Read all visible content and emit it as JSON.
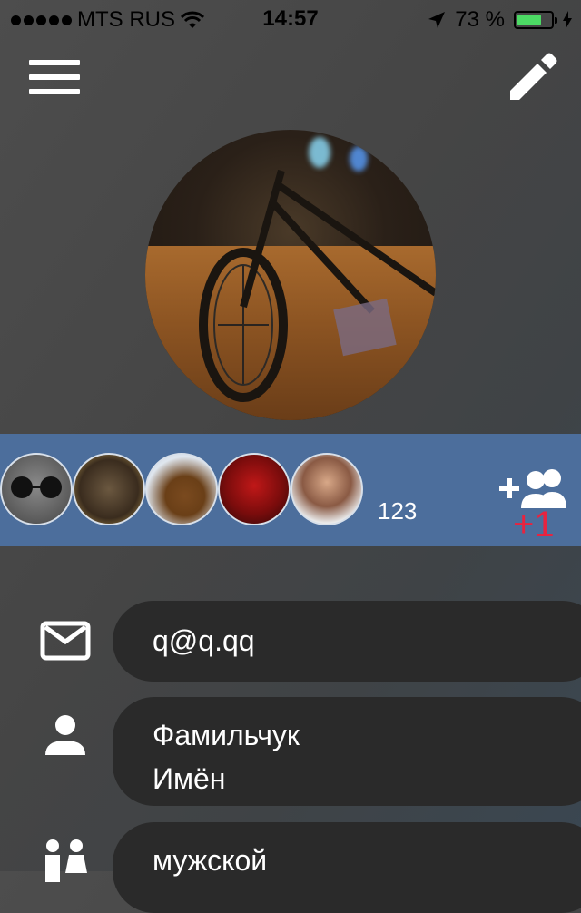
{
  "status_bar": {
    "carrier": "MTS RUS",
    "time": "14:57",
    "battery_percent": "73 %",
    "battery_level": 0.73
  },
  "header": {
    "menu_icon": "hamburger-menu-icon",
    "edit_icon": "pencil-icon"
  },
  "friends": {
    "count": "123",
    "add_badge": "+1",
    "add_icon": "add-friends-icon",
    "avatars": [
      "friend-avatar-cat",
      "friend-avatar-raccoon",
      "friend-avatar-dog",
      "friend-avatar-darth-maul",
      "friend-avatar-wrestler"
    ]
  },
  "profile": {
    "email": "q@q.qq",
    "last_name": "Фамильчук",
    "first_name": "Имён",
    "gender": "мужской"
  },
  "colors": {
    "band": "#4c6e9c",
    "badge_red": "#e8233f",
    "pill": "#2a2a2a",
    "battery_green": "#4cd964"
  }
}
